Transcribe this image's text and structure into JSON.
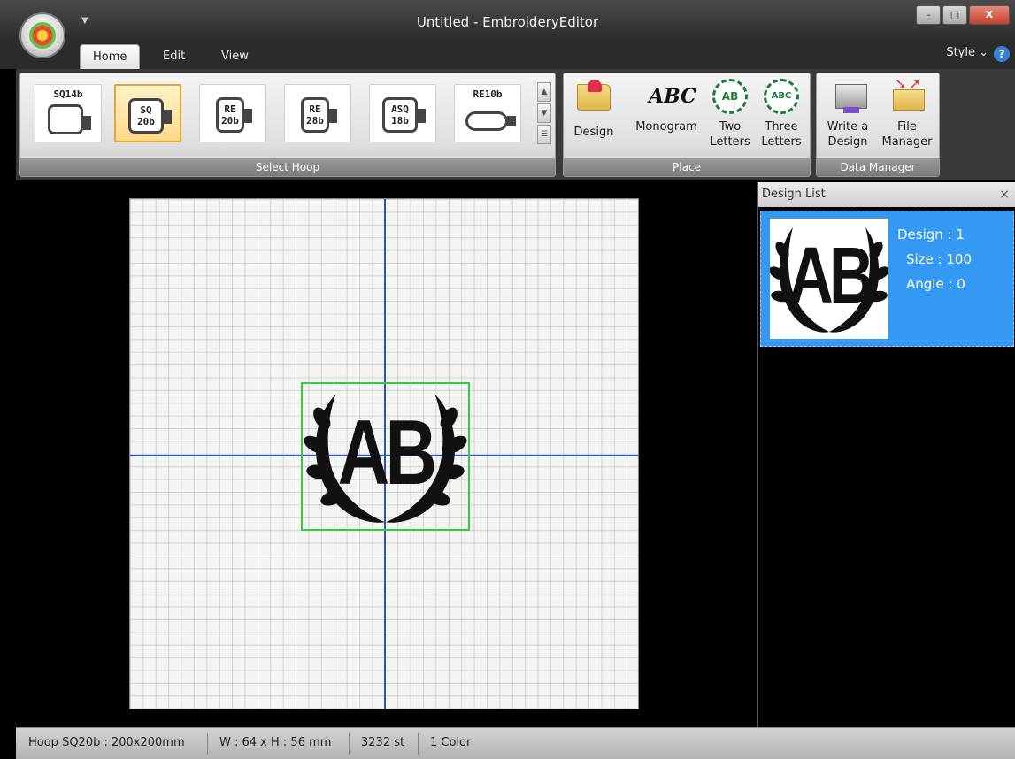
{
  "window": {
    "title": "Untitled - EmbroideryEditor",
    "quick_access": "▼"
  },
  "window_buttons": {
    "minimize": "–",
    "maximize": "□",
    "close": "X"
  },
  "tabs": [
    {
      "label": "Home"
    },
    {
      "label": "Edit"
    },
    {
      "label": "View"
    }
  ],
  "style_menu": "Style ⌄",
  "help": "?",
  "ribbon": {
    "select_hoop": {
      "label": "Select Hoop",
      "hoops": [
        {
          "label": "SQ14b",
          "selected": false
        },
        {
          "label": "SQ\n20b",
          "selected": true
        },
        {
          "label": "RE\n20b",
          "selected": false
        },
        {
          "label": "RE\n28b",
          "selected": false
        },
        {
          "label": "ASQ\n18b",
          "selected": false
        },
        {
          "label": "RE10b",
          "selected": false
        }
      ],
      "scroll_up": "▲",
      "scroll_down": "▼",
      "scroll_more": "☰"
    },
    "place": {
      "label": "Place",
      "design": "Design",
      "monogram": "Monogram",
      "monogram_icon_text": "ABC",
      "two_letters": "Two\nLetters",
      "two_letters_icon_text": "AB",
      "three_letters": "Three\nLetters",
      "three_letters_icon_text": "ABC"
    },
    "data_manager": {
      "label": "Data Manager",
      "write_design": "Write a\nDesign",
      "file_manager": "File\nManager"
    }
  },
  "canvas": {
    "monogram": "AB"
  },
  "design_list": {
    "title": "Design List",
    "close": "×",
    "items": [
      {
        "design": "Design : 1",
        "size": "Size : 100",
        "angle": "Angle : 0",
        "thumb_text": "AB"
      }
    ]
  },
  "status": {
    "hoop": "Hoop SQ20b : 200x200mm",
    "dimensions": "W : 64 x H : 56 mm",
    "stitches": "3232 st",
    "colors": "1 Color"
  }
}
